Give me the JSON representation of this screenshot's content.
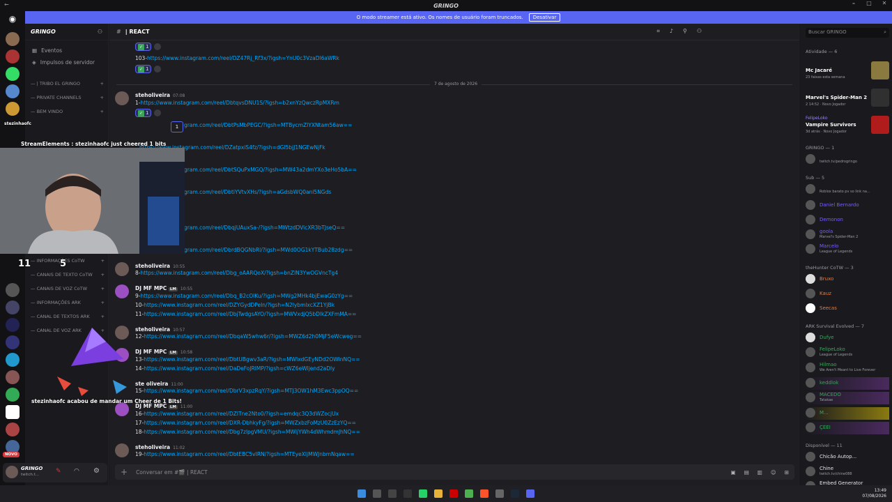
{
  "window": {
    "title": "GRINGO",
    "back": "←"
  },
  "banner": {
    "text": "O modo streamer está ativo. Os nomes de usuário foram truncados.",
    "button": "Desativar"
  },
  "server": {
    "name": "GRINGO"
  },
  "channels": {
    "items": [
      {
        "label": "Eventos"
      },
      {
        "label": "Impulsos de servidor"
      }
    ],
    "categories": [
      "— | TRIBO EL GRINGO",
      "— PRIVATE CHANNELS",
      "— BEM VINDO",
      "— INFORMAÇÕES CoTW",
      "— CANAIS DE TEXTO CoTW",
      "— CANAIS DE VOZ CoTW",
      "— INFORMAÇÕES ARK",
      "— CANAL DE TEXTOS ARK",
      "— CANAL DE VOZ ARK"
    ]
  },
  "channel_header": {
    "name": "| REACT",
    "search_placeholder": "Buscar GRINGO"
  },
  "messages": {
    "top_link_prefix": "103-",
    "top_link": "https://www.instagram.com/reel/DZ47Rj_Rf3x/?igsh=YnU0c3VzaDl6aWRk",
    "reaction_count": "1",
    "date_divider": "7 de agosto de 2026",
    "groups": [
      {
        "user": "steholiveira",
        "time": "07:08",
        "lines": [
          {
            "prefix": "1-",
            "url": "https://www.instagram.com/reel/DbtqvsDNU1S/?igsh=b2xnYzQwczRpMXRm"
          }
        ]
      },
      {
        "user": "",
        "time": "",
        "lines": [
          {
            "prefix": "",
            "url": "gram.com/reel/DbtPsMbPEGC/?igsh=MTBycmZlYXNtam56aw=="
          },
          {
            "prefix": "",
            "url": "https://www.instagram.com/reel/DZatpxiS4fz/?igsh=dGl5bjJ1NGEwNjFk"
          },
          {
            "prefix": "",
            "url": "gram.com/reel/DbtSQuPxMGQ/?igsh=MW43a2dmYXo3eHo5bA=="
          },
          {
            "prefix": "",
            "url": "gram.com/reel/DbtiYVtvXHs/?igsh=aGdsbWQ0anl5NGds"
          },
          {
            "prefix": "",
            "url": "gram.com/reel/DbqjUAuxSa-/?igsh=MWtzdDVicXR3bTJseQ=="
          },
          {
            "prefix": "",
            "url": "gram.com/reel/DbrdBQGNbRl/?igsh=MWd0OG1kYTBub28zdg=="
          }
        ]
      },
      {
        "user": "steholiveira",
        "time": "10:55",
        "lines": [
          {
            "prefix": "8-",
            "url": "https://www.instagram.com/reel/Dbg_oAARQoX/?igsh=bnZlN3YwOGVncTg4"
          }
        ]
      },
      {
        "user": "DJ MF MPC",
        "badge": "LM",
        "time": "10:55",
        "lines": [
          {
            "prefix": "9-",
            "url": "https://www.instagram.com/reel/Dbq_B2cOlKu/?igsh=MWg2MHk4bjEwaG0zYg=="
          },
          {
            "prefix": "10-",
            "url": "https://www.instagram.com/reel/DZYGydDPeIn/?igsh=N2lybmlxcXZ1YjBk"
          },
          {
            "prefix": "11-",
            "url": "https://www.instagram.com/reel/DbjTwdgsAYO/?igsh=MWVxdjQ5bDlkZXFmMA=="
          }
        ]
      },
      {
        "user": "steholiveira",
        "time": "10:57",
        "lines": [
          {
            "prefix": "12-",
            "url": "https://www.instagram.com/reel/DbqaW5whw6r/?igsh=MWZ6d2h0MjF5eWcweg=="
          }
        ]
      },
      {
        "user": "DJ MF MPC",
        "badge": "LM",
        "time": "10:58",
        "lines": [
          {
            "prefix": "13-",
            "url": "https://www.instagram.com/reel/DbtUBgwv3aR/?igsh=MWlxdGEyNDd2OWlnNQ=="
          },
          {
            "prefix": "14-",
            "url": "https://www.instagram.com/reel/DaDeFoJRlMP/?igsh=cWZ6eWljend2aDly"
          }
        ]
      },
      {
        "user": "ste oliveira",
        "time": "11:00",
        "lines": [
          {
            "prefix": "15-",
            "url": "https://www.instagram.com/reel/DbrV3xpzRqY/?igsh=MTJ3OW1hM3Ewc3ppOQ=="
          }
        ]
      },
      {
        "user": "DJ MF MPC",
        "badge": "LM",
        "time": "11:00",
        "lines": [
          {
            "prefix": "16-",
            "url": "https://www.instagram.com/reel/DZITne2Nto0/?igsh=emdqc3Q3dWZocjUx"
          },
          {
            "prefix": "17-",
            "url": "https://www.instagram.com/reel/DXR-DbhkyFg/?igsh=MWZxbzFoMzU0ZzEzYQ=="
          },
          {
            "prefix": "18-",
            "url": "https://www.instagram.com/reel/Dbg7zlpgVMU/?igsh=MWljYWh4dWhmdmJhNQ=="
          }
        ]
      },
      {
        "user": "steholiveira",
        "time": "11:02",
        "lines": [
          {
            "prefix": "19-",
            "url": "https://www.instagram.com/reel/DbtEBC5vIRN/?igsh=MTEyeXljMWJnbmNqaw=="
          }
        ]
      }
    ]
  },
  "composer": {
    "placeholder": "Conversar em #🎬 | REACT"
  },
  "members": {
    "activity_header": "Atividade — 6",
    "activities": [
      {
        "name": "",
        "game": "Mc Jacaré",
        "sub": "23 faixas esta semana",
        "color": "#8a7a40"
      },
      {
        "name": "",
        "game": "Marvel's Spider-Man 2",
        "sub": "2 14:52 · Novo Jogador",
        "color": "#303030"
      },
      {
        "name": "FelipeLoko",
        "game": "Vampire Survivors",
        "sub": "3d atrás · Novo Jogador",
        "color": "#b01c1c"
      }
    ],
    "sections": [
      {
        "title": "GRINGO — 1",
        "members": [
          {
            "name": "",
            "status": "twitch.tv/pedrogringo",
            "color": "#9b84ff"
          }
        ]
      },
      {
        "title": "Sub — 5",
        "members": [
          {
            "name": "",
            "status": "Roblox barato pv so link na...",
            "color": "#9b84ff"
          },
          {
            "name": "Daniel Bernardo",
            "status": "",
            "color": "#7a5cff"
          },
          {
            "name": "Demonon",
            "status": "",
            "color": "#7a5cff"
          },
          {
            "name": "goola",
            "status": "Marvel's Spider-Man 2",
            "color": "#7a5cff"
          },
          {
            "name": "Marcelo",
            "status": "League of Legends",
            "color": "#7a5cff"
          }
        ]
      },
      {
        "title": "theHunter CoTW — 3",
        "members": [
          {
            "name": "Bruxo",
            "status": "",
            "color": "#f57731"
          },
          {
            "name": "Kauz",
            "status": "",
            "color": "#f57731"
          },
          {
            "name": "Seecas",
            "status": "",
            "color": "#f57731"
          }
        ]
      },
      {
        "title": "ARK Survival Evolved — 7",
        "members": [
          {
            "name": "Dufye",
            "status": "",
            "color": "#3ba55c"
          },
          {
            "name": "FelipeLoko",
            "status": "League of Legends",
            "color": "#3ba55c"
          },
          {
            "name": "Hilmao",
            "status": "We Aren't Meant to Live Forever",
            "color": "#3ba55c"
          },
          {
            "name": "keddlok",
            "status": "",
            "color": "#3ba55c"
          },
          {
            "name": "MACEDO",
            "status": "Tatakae",
            "color": "#3ba55c"
          },
          {
            "name": "M...",
            "status": "",
            "color": "#3ba55c"
          },
          {
            "name": "ÇEEI",
            "status": "",
            "color": "#3ba55c"
          }
        ]
      },
      {
        "title": "Disponível — 11",
        "members": [
          {
            "name": "Chicão Autop...",
            "status": "",
            "color": "#e5e6e8"
          },
          {
            "name": "Chine",
            "status": "twitch.tv/chine088",
            "color": "#e5e6e8"
          },
          {
            "name": "Embed Generator",
            "status": "",
            "color": "#e5e6e8"
          }
        ]
      }
    ]
  },
  "user_panel": {
    "name": "GRINGO",
    "status": "twitch.t..."
  },
  "overlay": {
    "chat_user": "stezinhaofc",
    "se_line": "StreamElements : stezinhaofc just cheered 1 bits",
    "cheer_text": "stezinhaofc acabou de mandar um Cheer de 1 Bits!",
    "counter_a": "11",
    "counter_b": "5",
    "novo": "NOVO"
  },
  "clock": {
    "time": "13:49",
    "date": "07/08/2026"
  },
  "colors": {
    "accent": "#5865f2",
    "link": "#00a8fc",
    "bg": "#1e1e22"
  }
}
